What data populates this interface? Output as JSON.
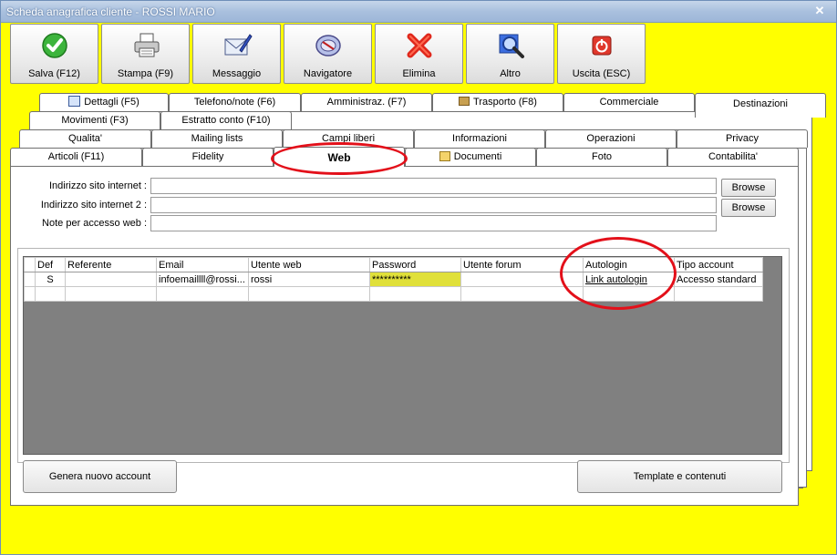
{
  "window": {
    "title": "Scheda anagrafica cliente - ROSSI MARIO"
  },
  "toolbar": [
    {
      "label": "Salva (F12)",
      "icon": "check-icon"
    },
    {
      "label": "Stampa (F9)",
      "icon": "printer-icon"
    },
    {
      "label": "Messaggio",
      "icon": "envelope-pen-icon"
    },
    {
      "label": "Navigatore",
      "icon": "compass-icon"
    },
    {
      "label": "Elimina",
      "icon": "red-x-icon"
    },
    {
      "label": "Altro",
      "icon": "magnifier-icon"
    },
    {
      "label": "Uscita (ESC)",
      "icon": "power-icon"
    }
  ],
  "tabs": {
    "row1": [
      "Dettagli (F5)",
      "Telefono/note (F6)",
      "Amministraz. (F7)",
      "Trasporto (F8)",
      "Commerciale",
      "Destinazioni"
    ],
    "row2": [
      "Movimenti (F3)",
      "Estratto conto (F10)"
    ],
    "row3": [
      "Qualita'",
      "Mailing lists",
      "Campi liberi",
      "Informazioni",
      "Operazioni",
      "Privacy"
    ],
    "row4": [
      "Articoli (F11)",
      "Fidelity",
      "Web",
      "Documenti",
      "Foto",
      "Contabilita'"
    ]
  },
  "form": {
    "site1_label": "Indirizzo sito internet :",
    "site2_label": "Indirizzo sito internet 2 :",
    "notes_label": "Note per accesso web :",
    "site1_value": "",
    "site2_value": "",
    "notes_value": "",
    "browse_label": "Browse"
  },
  "grid": {
    "columns": [
      "Def",
      "Referente",
      "Email",
      "Utente web",
      "Password",
      "Utente forum",
      "Autologin",
      "Tipo account"
    ],
    "rows": [
      [
        "S",
        "",
        "infoemaillll@rossi...",
        "rossi",
        "**********",
        "",
        "Link autologin",
        "Accesso standard"
      ],
      [
        "",
        "",
        "",
        "",
        "",
        "",
        "",
        ""
      ]
    ]
  },
  "buttons": {
    "new_account": "Genera nuovo account",
    "templates": "Template e contenuti"
  },
  "colors": {
    "background": "#ffff00",
    "highlight_ring": "#e3101a",
    "password_cell": "#e0e03a"
  }
}
